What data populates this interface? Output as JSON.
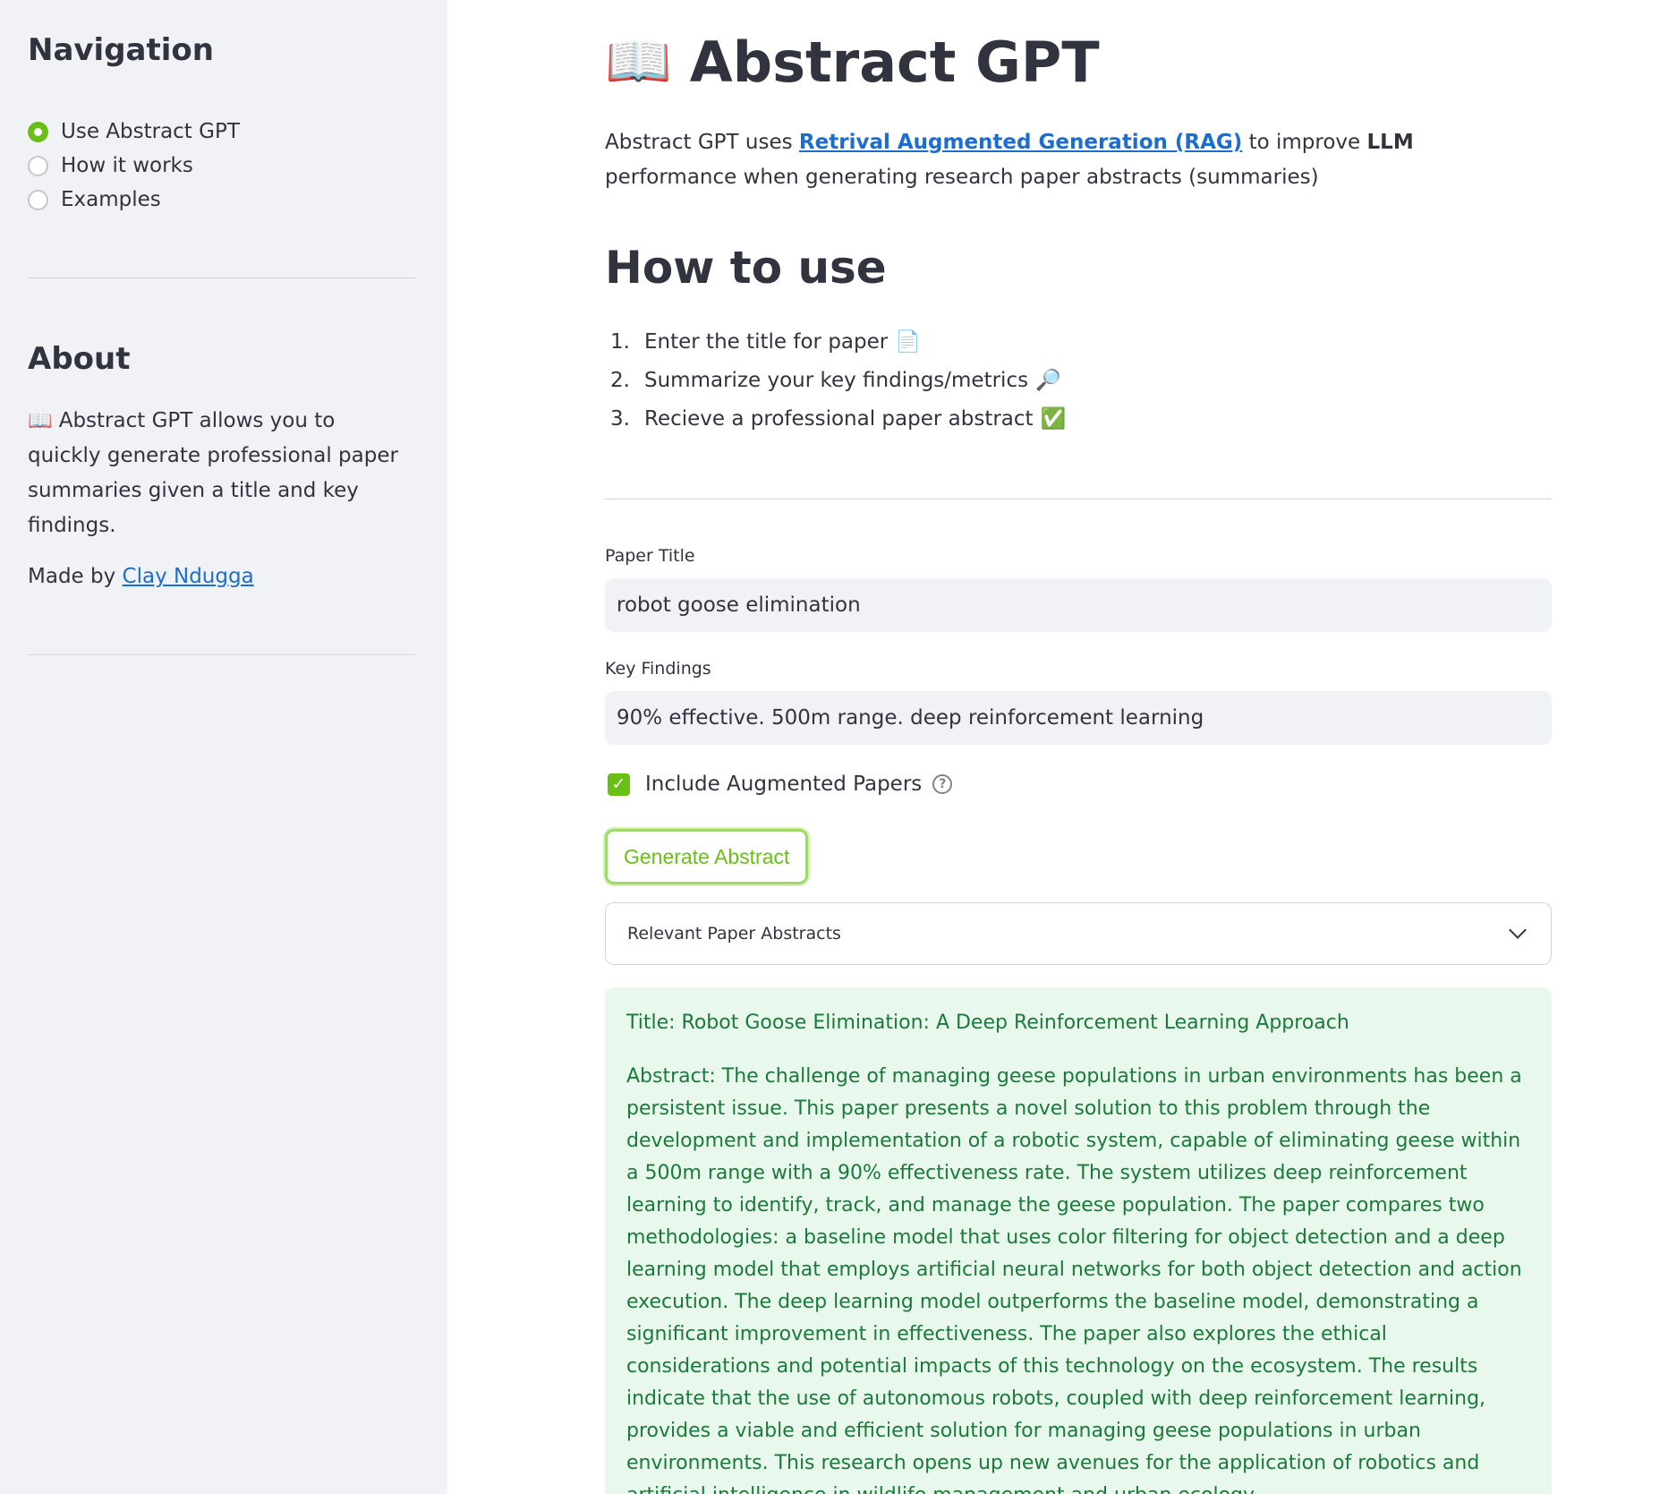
{
  "sidebar": {
    "title": "Navigation",
    "radio": [
      {
        "label": "Use Abstract GPT",
        "selected": true
      },
      {
        "label": "How it works",
        "selected": false
      },
      {
        "label": "Examples",
        "selected": false
      }
    ],
    "about_title": "About",
    "about_text": "Abstract GPT allows you to quickly generate professional paper summaries given a title and key findings.",
    "made_by_prefix": "Made by",
    "made_by_link": "Clay Ndugga"
  },
  "main": {
    "title": "Abstract GPT",
    "intro": {
      "prefix": "Abstract GPT uses",
      "link": "Retrival Augmented Generation (RAG)",
      "middle": "to improve",
      "bold": "LLM",
      "suffix": "performance when generating research paper abstracts (summaries)"
    },
    "how_to_title": "How to use",
    "steps": [
      {
        "num": "1.",
        "text": "Enter the title for paper",
        "emoji": "📄"
      },
      {
        "num": "2.",
        "text": "Summarize your key findings/metrics",
        "emoji": "🔎"
      },
      {
        "num": "3.",
        "text": "Recieve a professional paper abstract",
        "emoji": "✅"
      }
    ],
    "paper_title_label": "Paper Title",
    "paper_title_value": "robot goose elimination",
    "key_findings_label": "Key Findings",
    "key_findings_value": "90% effective. 500m range. deep reinforcement learning",
    "checkbox_label": "Include Augmented Papers",
    "generate_button": "Generate Abstract",
    "expander_label": "Relevant Paper Abstracts",
    "result_title": "Title: Robot Goose Elimination: A Deep Reinforcement Learning Approach",
    "result_abstract": "Abstract: The challenge of managing geese populations in urban environments has been a persistent issue. This paper presents a novel solution to this problem through the development and implementation of a robotic system, capable of eliminating geese within a 500m range with a 90% effectiveness rate. The system utilizes deep reinforcement learning to identify, track, and manage the geese population. The paper compares two methodologies: a baseline model that uses color filtering for object detection and a deep learning model that employs artificial neural networks for both object detection and action execution. The deep learning model outperforms the baseline model, demonstrating a significant improvement in effectiveness. The paper also explores the ethical considerations and potential impacts of this technology on the ecosystem. The results indicate that the use of autonomous robots, coupled with deep reinforcement learning, provides a viable and efficient solution for managing geese populations in urban environments. This research opens up new avenues for the application of robotics and artificial intelligence in wildlife management and urban ecology."
  },
  "colors": {
    "accent": "#6abf16",
    "sidebar_bg": "#f0f2f6",
    "result_bg": "#e8f8ec",
    "result_text": "#1b7a3a",
    "link": "#1c6dd0"
  }
}
